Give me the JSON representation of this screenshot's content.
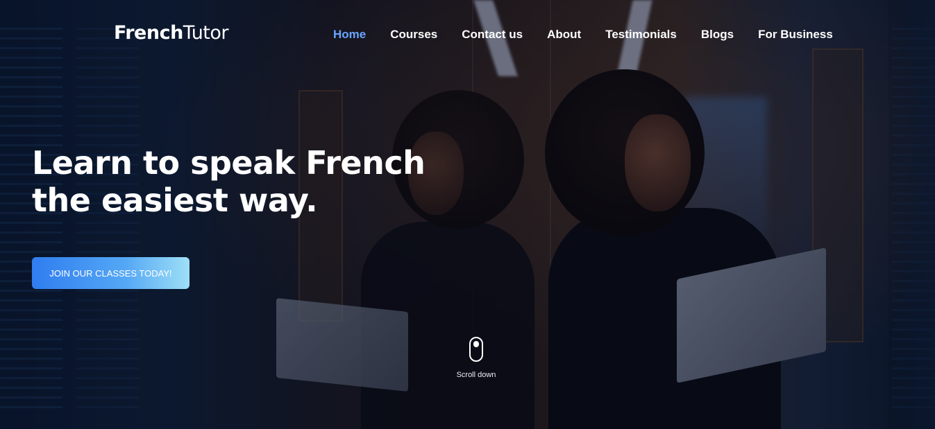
{
  "brand": {
    "logo_bold": "French",
    "logo_regular": "Tutor"
  },
  "nav": {
    "items": [
      {
        "label": "Home",
        "active": true
      },
      {
        "label": "Courses",
        "active": false
      },
      {
        "label": "Contact us",
        "active": false
      },
      {
        "label": "About",
        "active": false
      },
      {
        "label": "Testimonials",
        "active": false
      },
      {
        "label": "Blogs",
        "active": false
      },
      {
        "label": "For Business",
        "active": false
      }
    ]
  },
  "hero": {
    "headline_line1": "Learn to speak French",
    "headline_line2": "the easiest way.",
    "cta_label": "JOIN OUR CLASSES TODAY!",
    "scroll_label": "Scroll down"
  },
  "colors": {
    "nav_active": "#6aa6ff",
    "cta_gradient_start": "#2f7df0",
    "cta_gradient_end": "#9fe0f6",
    "text": "#ffffff"
  }
}
